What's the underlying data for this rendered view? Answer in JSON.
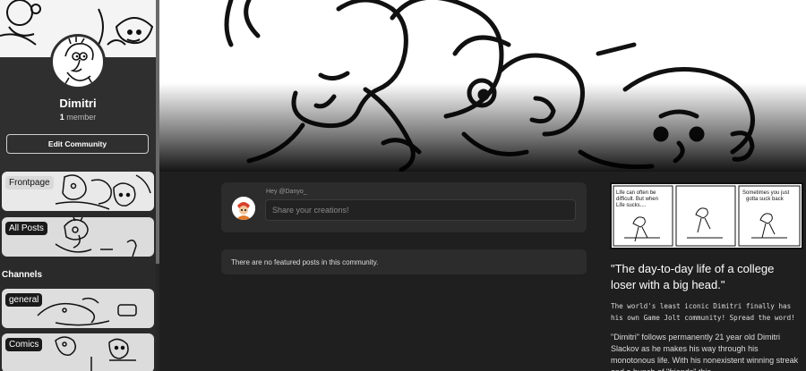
{
  "sidebar": {
    "community_name": "Dimitri",
    "member_count": "1",
    "member_label": "member",
    "edit_button": "Edit Community",
    "tiles": [
      {
        "label": "Frontpage"
      },
      {
        "label": "All Posts"
      }
    ],
    "channels_heading": "Channels",
    "channels": [
      {
        "label": "general"
      },
      {
        "label": "Comics"
      }
    ]
  },
  "composer": {
    "greeting": "Hey @Danyo_",
    "placeholder": "Share your creations!"
  },
  "feed": {
    "empty_message": "There are no featured posts in this community."
  },
  "about": {
    "comic": {
      "panel1": "Life can often be difficult. But when Life sucks....",
      "panel3": "Sometimes you just gotta suck back"
    },
    "headline": "\"The day-to-day life of a college loser with a big head.\"",
    "tagline": " The world's least iconic Dimitri finally has his own Game Jolt community! Spread the word!",
    "description": "\"Dimitri\" follows permanently 21 year old Dimitri Slackov as he makes his way through his monotonous life.  With his nonexistent winning streak and a bunch of \"friends\" this"
  },
  "colors": {
    "background": "#1f1f1f",
    "panel": "#2c2c2c",
    "sidebar": "#2a2a2a"
  }
}
